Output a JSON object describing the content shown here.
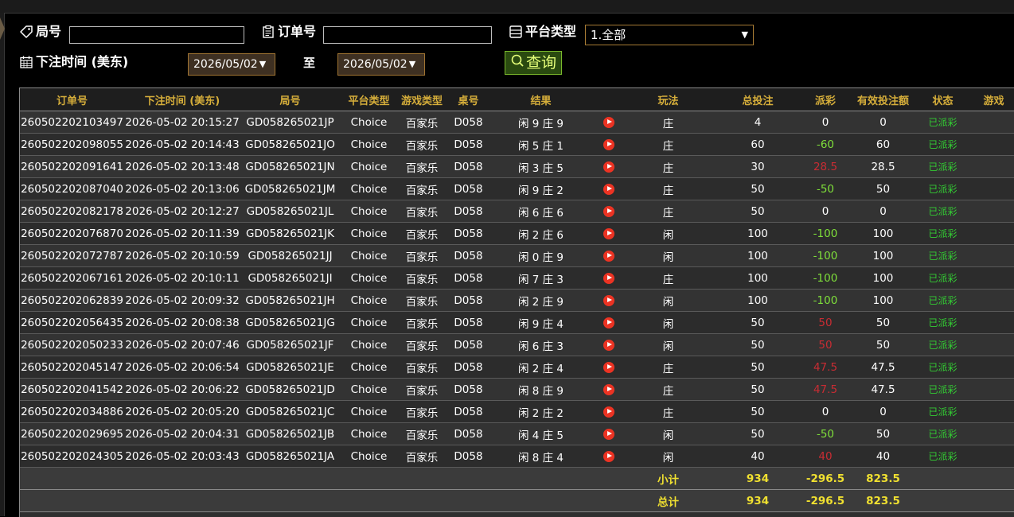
{
  "filters": {
    "round_label": "局号",
    "round_value": "",
    "order_label": "订单号",
    "order_value": "",
    "platform_label": "平台类型",
    "platform_value": "1.全部",
    "time_label": "下注时间 (美东)",
    "date_from": "2026/05/02",
    "date_to": "2026/05/02",
    "to_label": "至",
    "query_label": "查询"
  },
  "table": {
    "headers": [
      "订单号",
      "下注时间 (美东)",
      "局号",
      "平台类型",
      "游戏类型",
      "桌号",
      "结果",
      "",
      "玩法",
      "总投注",
      "派彩",
      "有效投注额",
      "状态",
      "游戏"
    ],
    "rows": [
      {
        "order": "260502202103497",
        "time": "2026-05-02 20:15:27",
        "round": "GD058265021JP",
        "platform": "Choice",
        "game": "百家乐",
        "table": "D058",
        "result": "闲 9 庄 9",
        "play": "庄",
        "bet": "4",
        "payout": "0",
        "payout_type": "zero",
        "valid": "0",
        "status": "已派彩"
      },
      {
        "order": "260502202098055",
        "time": "2026-05-02 20:14:43",
        "round": "GD058265021JO",
        "platform": "Choice",
        "game": "百家乐",
        "table": "D058",
        "result": "闲 5 庄 1",
        "play": "庄",
        "bet": "60",
        "payout": "-60",
        "payout_type": "pos",
        "valid": "60",
        "status": "已派彩"
      },
      {
        "order": "260502202091641",
        "time": "2026-05-02 20:13:48",
        "round": "GD058265021JN",
        "platform": "Choice",
        "game": "百家乐",
        "table": "D058",
        "result": "闲 3 庄 5",
        "play": "庄",
        "bet": "30",
        "payout": "28.5",
        "payout_type": "neg",
        "valid": "28.5",
        "status": "已派彩"
      },
      {
        "order": "260502202087040",
        "time": "2026-05-02 20:13:06",
        "round": "GD058265021JM",
        "platform": "Choice",
        "game": "百家乐",
        "table": "D058",
        "result": "闲 9 庄 2",
        "play": "庄",
        "bet": "50",
        "payout": "-50",
        "payout_type": "pos",
        "valid": "50",
        "status": "已派彩"
      },
      {
        "order": "260502202082178",
        "time": "2026-05-02 20:12:27",
        "round": "GD058265021JL",
        "platform": "Choice",
        "game": "百家乐",
        "table": "D058",
        "result": "闲 6 庄 6",
        "play": "庄",
        "bet": "50",
        "payout": "0",
        "payout_type": "zero",
        "valid": "0",
        "status": "已派彩"
      },
      {
        "order": "260502202076870",
        "time": "2026-05-02 20:11:39",
        "round": "GD058265021JK",
        "platform": "Choice",
        "game": "百家乐",
        "table": "D058",
        "result": "闲 2 庄 6",
        "play": "闲",
        "bet": "100",
        "payout": "-100",
        "payout_type": "pos",
        "valid": "100",
        "status": "已派彩"
      },
      {
        "order": "260502202072787",
        "time": "2026-05-02 20:10:59",
        "round": "GD058265021JJ",
        "platform": "Choice",
        "game": "百家乐",
        "table": "D058",
        "result": "闲 0 庄 9",
        "play": "闲",
        "bet": "100",
        "payout": "-100",
        "payout_type": "pos",
        "valid": "100",
        "status": "已派彩"
      },
      {
        "order": "260502202067161",
        "time": "2026-05-02 20:10:11",
        "round": "GD058265021JI",
        "platform": "Choice",
        "game": "百家乐",
        "table": "D058",
        "result": "闲 7 庄 3",
        "play": "庄",
        "bet": "100",
        "payout": "-100",
        "payout_type": "pos",
        "valid": "100",
        "status": "已派彩"
      },
      {
        "order": "260502202062839",
        "time": "2026-05-02 20:09:32",
        "round": "GD058265021JH",
        "platform": "Choice",
        "game": "百家乐",
        "table": "D058",
        "result": "闲 2 庄 9",
        "play": "闲",
        "bet": "100",
        "payout": "-100",
        "payout_type": "pos",
        "valid": "100",
        "status": "已派彩"
      },
      {
        "order": "260502202056435",
        "time": "2026-05-02 20:08:38",
        "round": "GD058265021JG",
        "platform": "Choice",
        "game": "百家乐",
        "table": "D058",
        "result": "闲 9 庄 4",
        "play": "闲",
        "bet": "50",
        "payout": "50",
        "payout_type": "neg",
        "valid": "50",
        "status": "已派彩"
      },
      {
        "order": "260502202050233",
        "time": "2026-05-02 20:07:46",
        "round": "GD058265021JF",
        "platform": "Choice",
        "game": "百家乐",
        "table": "D058",
        "result": "闲 6 庄 3",
        "play": "闲",
        "bet": "50",
        "payout": "50",
        "payout_type": "neg",
        "valid": "50",
        "status": "已派彩"
      },
      {
        "order": "260502202045147",
        "time": "2026-05-02 20:06:54",
        "round": "GD058265021JE",
        "platform": "Choice",
        "game": "百家乐",
        "table": "D058",
        "result": "闲 2 庄 4",
        "play": "庄",
        "bet": "50",
        "payout": "47.5",
        "payout_type": "neg",
        "valid": "47.5",
        "status": "已派彩"
      },
      {
        "order": "260502202041542",
        "time": "2026-05-02 20:06:22",
        "round": "GD058265021JD",
        "platform": "Choice",
        "game": "百家乐",
        "table": "D058",
        "result": "闲 8 庄 9",
        "play": "庄",
        "bet": "50",
        "payout": "47.5",
        "payout_type": "neg",
        "valid": "47.5",
        "status": "已派彩"
      },
      {
        "order": "260502202034886",
        "time": "2026-05-02 20:05:20",
        "round": "GD058265021JC",
        "platform": "Choice",
        "game": "百家乐",
        "table": "D058",
        "result": "闲 2 庄 2",
        "play": "庄",
        "bet": "50",
        "payout": "0",
        "payout_type": "zero",
        "valid": "0",
        "status": "已派彩"
      },
      {
        "order": "260502202029695",
        "time": "2026-05-02 20:04:31",
        "round": "GD058265021JB",
        "platform": "Choice",
        "game": "百家乐",
        "table": "D058",
        "result": "闲 4 庄 5",
        "play": "闲",
        "bet": "50",
        "payout": "-50",
        "payout_type": "pos",
        "valid": "50",
        "status": "已派彩"
      },
      {
        "order": "260502202024305",
        "time": "2026-05-02 20:03:43",
        "round": "GD058265021JA",
        "platform": "Choice",
        "game": "百家乐",
        "table": "D058",
        "result": "闲 8 庄 4",
        "play": "闲",
        "bet": "40",
        "payout": "40",
        "payout_type": "neg",
        "valid": "40",
        "status": "已派彩"
      }
    ],
    "subtotal": {
      "label": "小计",
      "bet": "934",
      "payout": "-296.5",
      "valid": "823.5"
    },
    "total": {
      "label": "总计",
      "bet": "934",
      "payout": "-296.5",
      "valid": "823.5"
    }
  },
  "colors": {
    "header_text": "#d6ae3a",
    "payout_green": "#7fe03a",
    "payout_red": "#c82c33",
    "status_green": "#33cc33",
    "summary_yellow": "#f0e030"
  }
}
